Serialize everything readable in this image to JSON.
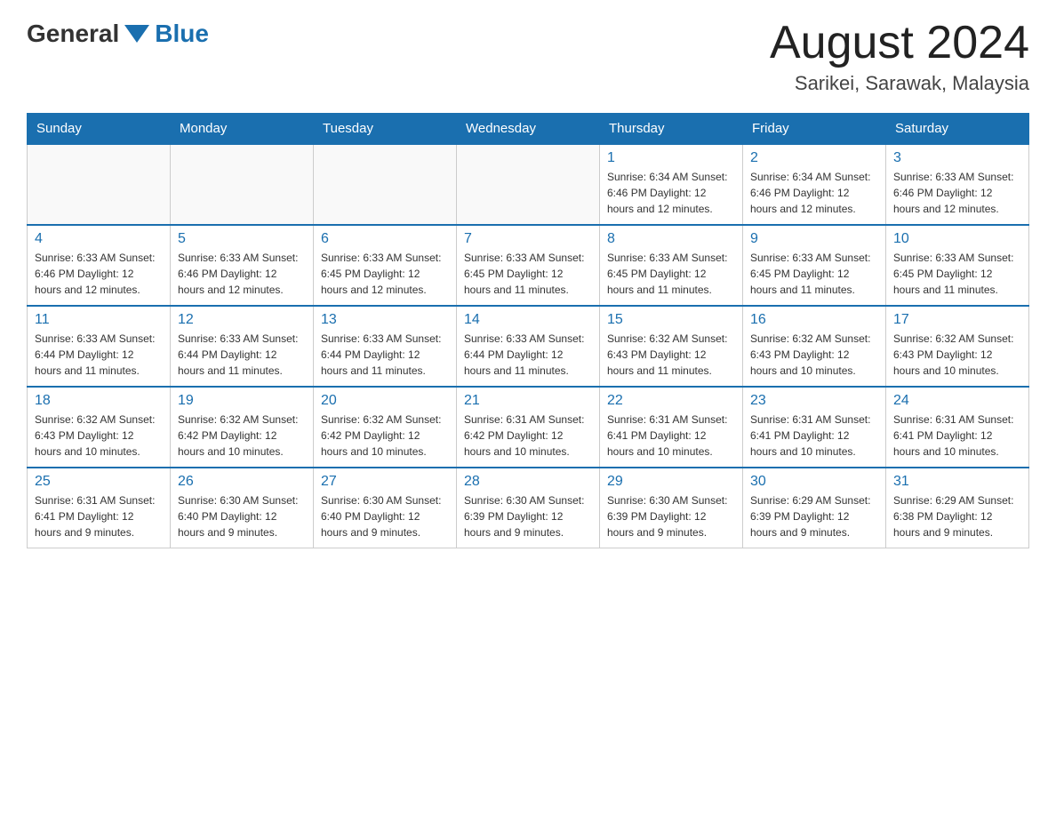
{
  "header": {
    "logo": {
      "text_general": "General",
      "text_blue": "Blue"
    },
    "month_title": "August 2024",
    "location": "Sarikei, Sarawak, Malaysia"
  },
  "days_of_week": [
    "Sunday",
    "Monday",
    "Tuesday",
    "Wednesday",
    "Thursday",
    "Friday",
    "Saturday"
  ],
  "weeks": [
    {
      "days": [
        {
          "number": "",
          "info": ""
        },
        {
          "number": "",
          "info": ""
        },
        {
          "number": "",
          "info": ""
        },
        {
          "number": "",
          "info": ""
        },
        {
          "number": "1",
          "info": "Sunrise: 6:34 AM\nSunset: 6:46 PM\nDaylight: 12 hours and 12 minutes."
        },
        {
          "number": "2",
          "info": "Sunrise: 6:34 AM\nSunset: 6:46 PM\nDaylight: 12 hours and 12 minutes."
        },
        {
          "number": "3",
          "info": "Sunrise: 6:33 AM\nSunset: 6:46 PM\nDaylight: 12 hours and 12 minutes."
        }
      ]
    },
    {
      "days": [
        {
          "number": "4",
          "info": "Sunrise: 6:33 AM\nSunset: 6:46 PM\nDaylight: 12 hours and 12 minutes."
        },
        {
          "number": "5",
          "info": "Sunrise: 6:33 AM\nSunset: 6:46 PM\nDaylight: 12 hours and 12 minutes."
        },
        {
          "number": "6",
          "info": "Sunrise: 6:33 AM\nSunset: 6:45 PM\nDaylight: 12 hours and 12 minutes."
        },
        {
          "number": "7",
          "info": "Sunrise: 6:33 AM\nSunset: 6:45 PM\nDaylight: 12 hours and 11 minutes."
        },
        {
          "number": "8",
          "info": "Sunrise: 6:33 AM\nSunset: 6:45 PM\nDaylight: 12 hours and 11 minutes."
        },
        {
          "number": "9",
          "info": "Sunrise: 6:33 AM\nSunset: 6:45 PM\nDaylight: 12 hours and 11 minutes."
        },
        {
          "number": "10",
          "info": "Sunrise: 6:33 AM\nSunset: 6:45 PM\nDaylight: 12 hours and 11 minutes."
        }
      ]
    },
    {
      "days": [
        {
          "number": "11",
          "info": "Sunrise: 6:33 AM\nSunset: 6:44 PM\nDaylight: 12 hours and 11 minutes."
        },
        {
          "number": "12",
          "info": "Sunrise: 6:33 AM\nSunset: 6:44 PM\nDaylight: 12 hours and 11 minutes."
        },
        {
          "number": "13",
          "info": "Sunrise: 6:33 AM\nSunset: 6:44 PM\nDaylight: 12 hours and 11 minutes."
        },
        {
          "number": "14",
          "info": "Sunrise: 6:33 AM\nSunset: 6:44 PM\nDaylight: 12 hours and 11 minutes."
        },
        {
          "number": "15",
          "info": "Sunrise: 6:32 AM\nSunset: 6:43 PM\nDaylight: 12 hours and 11 minutes."
        },
        {
          "number": "16",
          "info": "Sunrise: 6:32 AM\nSunset: 6:43 PM\nDaylight: 12 hours and 10 minutes."
        },
        {
          "number": "17",
          "info": "Sunrise: 6:32 AM\nSunset: 6:43 PM\nDaylight: 12 hours and 10 minutes."
        }
      ]
    },
    {
      "days": [
        {
          "number": "18",
          "info": "Sunrise: 6:32 AM\nSunset: 6:43 PM\nDaylight: 12 hours and 10 minutes."
        },
        {
          "number": "19",
          "info": "Sunrise: 6:32 AM\nSunset: 6:42 PM\nDaylight: 12 hours and 10 minutes."
        },
        {
          "number": "20",
          "info": "Sunrise: 6:32 AM\nSunset: 6:42 PM\nDaylight: 12 hours and 10 minutes."
        },
        {
          "number": "21",
          "info": "Sunrise: 6:31 AM\nSunset: 6:42 PM\nDaylight: 12 hours and 10 minutes."
        },
        {
          "number": "22",
          "info": "Sunrise: 6:31 AM\nSunset: 6:41 PM\nDaylight: 12 hours and 10 minutes."
        },
        {
          "number": "23",
          "info": "Sunrise: 6:31 AM\nSunset: 6:41 PM\nDaylight: 12 hours and 10 minutes."
        },
        {
          "number": "24",
          "info": "Sunrise: 6:31 AM\nSunset: 6:41 PM\nDaylight: 12 hours and 10 minutes."
        }
      ]
    },
    {
      "days": [
        {
          "number": "25",
          "info": "Sunrise: 6:31 AM\nSunset: 6:41 PM\nDaylight: 12 hours and 9 minutes."
        },
        {
          "number": "26",
          "info": "Sunrise: 6:30 AM\nSunset: 6:40 PM\nDaylight: 12 hours and 9 minutes."
        },
        {
          "number": "27",
          "info": "Sunrise: 6:30 AM\nSunset: 6:40 PM\nDaylight: 12 hours and 9 minutes."
        },
        {
          "number": "28",
          "info": "Sunrise: 6:30 AM\nSunset: 6:39 PM\nDaylight: 12 hours and 9 minutes."
        },
        {
          "number": "29",
          "info": "Sunrise: 6:30 AM\nSunset: 6:39 PM\nDaylight: 12 hours and 9 minutes."
        },
        {
          "number": "30",
          "info": "Sunrise: 6:29 AM\nSunset: 6:39 PM\nDaylight: 12 hours and 9 minutes."
        },
        {
          "number": "31",
          "info": "Sunrise: 6:29 AM\nSunset: 6:38 PM\nDaylight: 12 hours and 9 minutes."
        }
      ]
    }
  ]
}
